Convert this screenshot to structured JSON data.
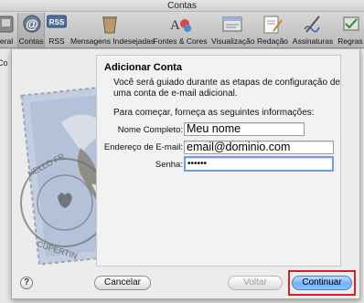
{
  "window": {
    "title": "Contas"
  },
  "toolbar": {
    "items": [
      {
        "label": "eral",
        "icon": "general-icon"
      },
      {
        "label": "Contas",
        "icon": "at-sign-icon"
      },
      {
        "label": "RSS",
        "icon": "rss-icon"
      },
      {
        "label": "Mensagens Indesejadas",
        "icon": "junk-mail-icon"
      },
      {
        "label": "Fontes & Cores",
        "icon": "fonts-colors-icon"
      },
      {
        "label": "Visualização",
        "icon": "viewing-icon"
      },
      {
        "label": "Redação",
        "icon": "composing-icon"
      },
      {
        "label": "Assinaturas",
        "icon": "signatures-icon"
      },
      {
        "label": "Regras",
        "icon": "rules-icon"
      }
    ]
  },
  "sidebar": {
    "partial_label": "Co"
  },
  "dialog": {
    "title": "Adicionar Conta",
    "intro": "Você será guiado durante as etapas de configuração de uma conta de e-mail adicional.",
    "prompt": "Para começar, forneça as seguintes informações:",
    "fields": {
      "full_name_label": "Nome Completo:",
      "full_name_value": "Meu nome",
      "email_label": "Endereço de E-mail:",
      "email_value": "email@dominio.com",
      "password_label": "Senha:",
      "password_value": "••••••"
    },
    "stamp_text": {
      "top": "HELLO FR",
      "bottom": "CUPERTIN"
    },
    "buttons": {
      "help": "?",
      "cancel": "Cancelar",
      "back": "Voltar",
      "continue": "Continuar"
    }
  },
  "colors": {
    "focus": "#6d9fd9",
    "highlight": "#d4202a",
    "default_button": "#6fb2ff"
  }
}
